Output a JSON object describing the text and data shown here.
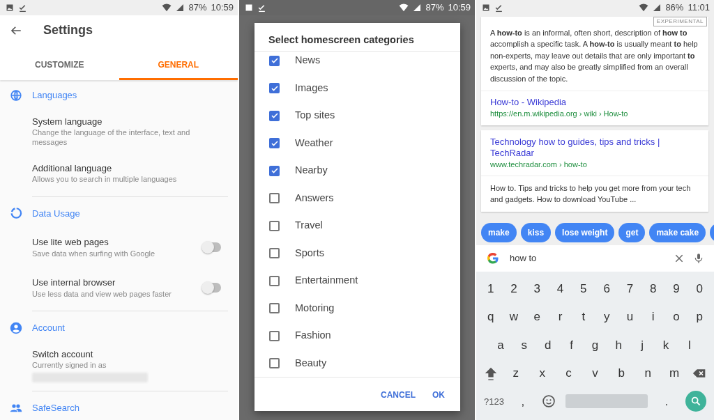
{
  "settings_screen": {
    "status_bar": {
      "battery": "87%",
      "time": "10:59"
    },
    "title": "Settings",
    "tabs": [
      {
        "label": "CUSTOMIZE",
        "selected": false
      },
      {
        "label": "GENERAL",
        "selected": true
      }
    ],
    "sections": [
      {
        "title": "Languages",
        "items": [
          {
            "kind": "plain",
            "title": "System language",
            "subtitle": "Change the language of the interface, text and messages"
          },
          {
            "kind": "plain",
            "title": "Additional language",
            "subtitle": "Allows you to search in multiple languages"
          }
        ]
      },
      {
        "title": "Data Usage",
        "items": [
          {
            "kind": "toggle",
            "title": "Use lite web pages",
            "subtitle": "Save data when surfing with Google",
            "on": false
          },
          {
            "kind": "toggle",
            "title": "Use internal browser",
            "subtitle": "Use less data and view web pages faster",
            "on": false
          }
        ]
      },
      {
        "title": "Account",
        "items": [
          {
            "kind": "account",
            "title": "Switch account",
            "subtitle": "Currently signed in as"
          }
        ]
      },
      {
        "title": "SafeSearch"
      }
    ]
  },
  "categories_dialog_screen": {
    "status_bar": {
      "battery": "87%",
      "time": "10:59"
    },
    "title": "Select homescreen categories",
    "options": [
      {
        "label": "News",
        "checked": true
      },
      {
        "label": "Images",
        "checked": true
      },
      {
        "label": "Top sites",
        "checked": true
      },
      {
        "label": "Weather",
        "checked": true
      },
      {
        "label": "Nearby",
        "checked": true
      },
      {
        "label": "Answers",
        "checked": false
      },
      {
        "label": "Travel",
        "checked": false
      },
      {
        "label": "Sports",
        "checked": false
      },
      {
        "label": "Entertainment",
        "checked": false
      },
      {
        "label": "Motoring",
        "checked": false
      },
      {
        "label": "Fashion",
        "checked": false
      },
      {
        "label": "Beauty",
        "checked": false
      }
    ],
    "buttons": [
      "CANCEL",
      "OK"
    ]
  },
  "search_screen": {
    "status_bar": {
      "battery": "86%",
      "time": "11:01"
    },
    "answer_card": {
      "badge": "EXPERIMENTAL",
      "snippet": "A **how-to** is an informal, often short, description of **how to** accomplish a specific task. A **how-to** is usually meant **to** help non-experts, may leave out details that are only important **to** experts, and may also be greatly simplified from an overall discussion of the topic.",
      "link_title": "How-to - Wikipedia",
      "url": "https://en.m.wikipedia.org › wiki › How-to"
    },
    "result_card": {
      "link_title": "Technology how to guides, tips and tricks | TechRadar",
      "url": "www.techradar.com › how-to",
      "snippet": "How to. Tips and tricks to help you get more from your tech and gadgets. How to download YouTube ..."
    },
    "suggestions": [
      "make",
      "kiss",
      "lose weight",
      "get",
      "make cake"
    ],
    "search_field": {
      "value": "how to"
    },
    "keyboard": {
      "number_row": [
        "1",
        "2",
        "3",
        "4",
        "5",
        "6",
        "7",
        "8",
        "9",
        "0"
      ],
      "top_letter_row": [
        "q",
        "w",
        "e",
        "r",
        "t",
        "y",
        "u",
        "i",
        "o",
        "p"
      ],
      "middle_letter_row": [
        "a",
        "s",
        "d",
        "f",
        "g",
        "h",
        "j",
        "k",
        "l"
      ],
      "bottom_letter_row": [
        "z",
        "x",
        "c",
        "v",
        "b",
        "n",
        "m"
      ],
      "symbols_key": "?123",
      "comma_key": ",",
      "period_key": "."
    }
  }
}
